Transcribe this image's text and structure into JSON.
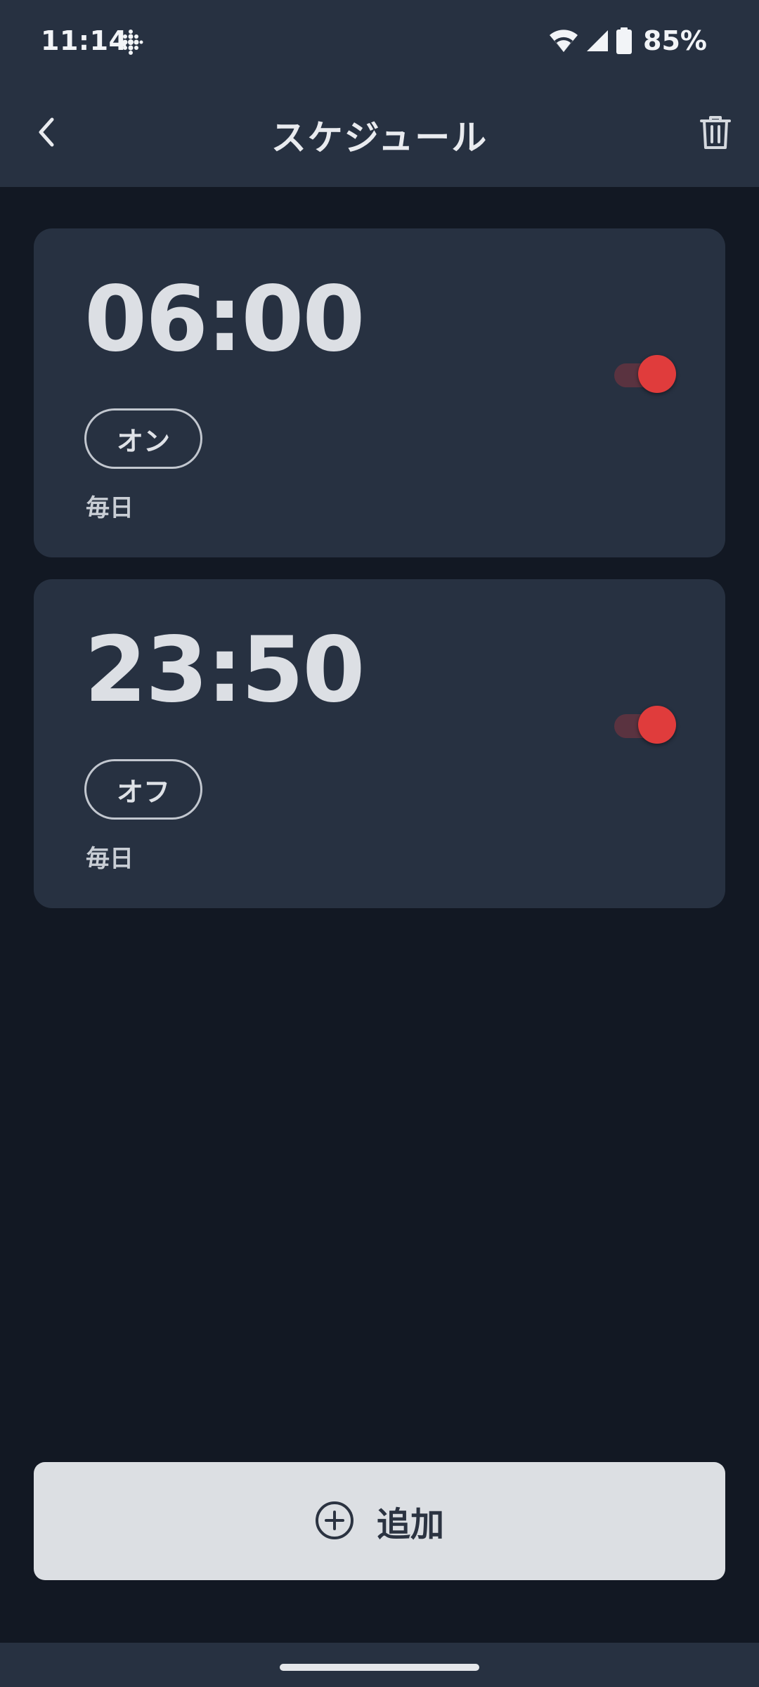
{
  "status_bar": {
    "time": "11:14",
    "app_icon": "fitbit-dots-icon",
    "wifi_icon": "wifi-icon",
    "signal_icon": "cell-signal-icon",
    "battery_icon": "battery-icon",
    "battery_percent": "85%"
  },
  "app_bar": {
    "title": "スケジュール",
    "back_icon": "chevron-left-icon",
    "delete_icon": "trash-icon"
  },
  "schedules": [
    {
      "time": "06:00",
      "action": "オン",
      "repeat": "毎日",
      "enabled": true
    },
    {
      "time": "23:50",
      "action": "オフ",
      "repeat": "毎日",
      "enabled": true
    }
  ],
  "add_button": {
    "label": "追加",
    "icon": "plus-circle-icon"
  },
  "colors": {
    "background": "#121823",
    "surface": "#273141",
    "accent": "#e03c3c",
    "button": "#dcdfe3"
  }
}
